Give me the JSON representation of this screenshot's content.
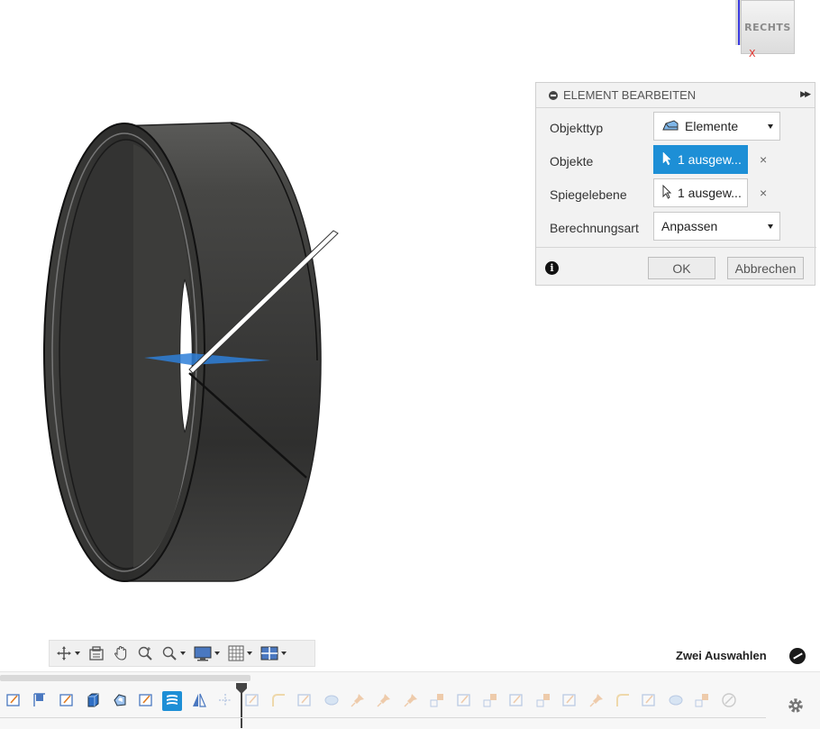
{
  "viewcube": {
    "face_label": "RECHTS",
    "axis_label": "X"
  },
  "dialog": {
    "title": "ELEMENT BEARBEITEN",
    "rows": [
      {
        "label": "Objekttyp",
        "value": "Elemente",
        "kind": "select",
        "icon": "bodies-icon"
      },
      {
        "label": "Objekte",
        "value": "1 ausgew...",
        "kind": "selection",
        "active": true,
        "icon": "cursor-icon"
      },
      {
        "label": "Spiegelebene",
        "value": "1 ausgew...",
        "kind": "selection",
        "active": false,
        "icon": "cursor-icon"
      },
      {
        "label": "Berechnungsart",
        "value": "Anpassen",
        "kind": "select"
      }
    ],
    "clear_symbol": "×",
    "ok_label": "OK",
    "cancel_label": "Abbrechen"
  },
  "navbar": {
    "tools": [
      "orbit-icon",
      "look-at-icon",
      "pan-icon",
      "zoom-icon",
      "fit-icon",
      "display-settings-icon",
      "grid-icon",
      "viewports-icon"
    ]
  },
  "status": {
    "text": "Zwei Auswahlen"
  },
  "timeline": {
    "items": [
      {
        "icon": "sketch-icon",
        "faded": false
      },
      {
        "icon": "plane-icon",
        "faded": false
      },
      {
        "icon": "sketch-icon",
        "faded": false
      },
      {
        "icon": "extrude-icon",
        "faded": false
      },
      {
        "icon": "shell-icon",
        "faded": false
      },
      {
        "icon": "sketch-icon",
        "faded": false
      },
      {
        "icon": "mirror-feature-icon",
        "faded": false,
        "highlight": true
      },
      {
        "icon": "mirror-icon",
        "faded": false
      },
      {
        "icon": "move-icon",
        "faded": true
      },
      {
        "icon": "sketch-icon",
        "faded": true
      },
      {
        "icon": "fillet-icon",
        "faded": true
      },
      {
        "icon": "sketch-icon",
        "faded": true
      },
      {
        "icon": "loft-icon",
        "faded": true
      },
      {
        "icon": "pin-icon",
        "faded": true
      },
      {
        "icon": "pin-icon",
        "faded": true
      },
      {
        "icon": "pin-icon",
        "faded": true
      },
      {
        "icon": "joint-icon",
        "faded": true
      },
      {
        "icon": "sketch-icon",
        "faded": true
      },
      {
        "icon": "joint-icon",
        "faded": true
      },
      {
        "icon": "sketch-icon",
        "faded": true
      },
      {
        "icon": "joint-icon",
        "faded": true
      },
      {
        "icon": "sketch-icon",
        "faded": true
      },
      {
        "icon": "pin-icon",
        "faded": true
      },
      {
        "icon": "fillet-icon",
        "faded": true
      },
      {
        "icon": "sketch-icon",
        "faded": true
      },
      {
        "icon": "loft-icon",
        "faded": true
      },
      {
        "icon": "joint-icon",
        "faded": true
      },
      {
        "icon": "link-icon",
        "faded": true
      }
    ]
  },
  "colors": {
    "accent": "#1d8fd6",
    "ring_dark": "#3a3a3a",
    "plane_blue": "#2e7fd8"
  }
}
